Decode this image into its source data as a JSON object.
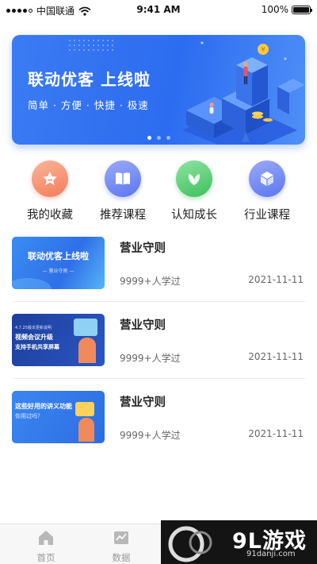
{
  "status_bar": {
    "carrier": "中国联通",
    "time": "9:41 AM",
    "battery": "100%",
    "battery_level": 1.0
  },
  "banner": {
    "title": "联动优客 上线啦",
    "subtitle": "简单 · 方便 · 快捷 · 极速",
    "page_count": 3,
    "active_page": 0,
    "colors": {
      "start": "#3b7bf2",
      "end": "#4f8ff7"
    }
  },
  "categories": [
    {
      "label": "我的收藏",
      "icon": "star-icon",
      "color": "#f47c5b"
    },
    {
      "label": "推荐课程",
      "icon": "book-icon",
      "color": "#5b76f0"
    },
    {
      "label": "认知成长",
      "icon": "leaf-icon",
      "color": "#3fbf5f"
    },
    {
      "label": "行业课程",
      "icon": "cube-icon",
      "color": "#5b76f0"
    }
  ],
  "courses": [
    {
      "title": "营业守则",
      "learners": "9999+人学过",
      "date": "2021-11-11",
      "thumb_title": "联动优客上线啦",
      "thumb_sub": "营业守则"
    },
    {
      "title": "营业守则",
      "learners": "9999+人学过",
      "date": "2021-11-11",
      "thumb_tag": "4.7.25版本更新说明",
      "thumb_title": "视频会议升级",
      "thumb_sub": "支持手机共享屏幕"
    },
    {
      "title": "营业守则",
      "learners": "9999+人学过",
      "date": "2021-11-11",
      "thumb_title": "这些好用的讲义功能",
      "thumb_sub": "你用过吗？"
    }
  ],
  "tabbar": {
    "tabs": [
      {
        "label": "首页",
        "icon": "home-icon"
      },
      {
        "label": "数据",
        "icon": "chart-icon"
      }
    ]
  },
  "watermark": {
    "text": "9L游戏",
    "sub": "91danji.com"
  }
}
